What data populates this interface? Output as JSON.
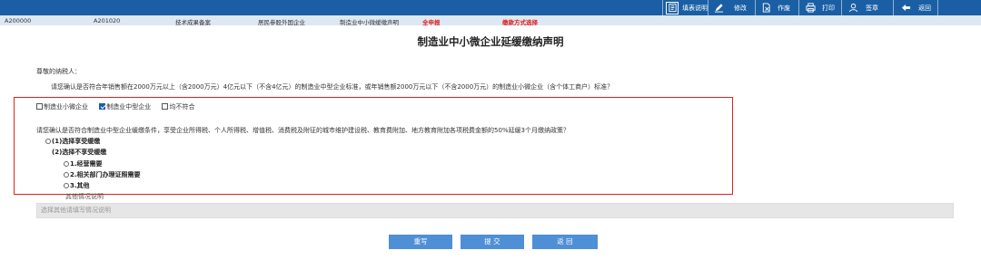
{
  "toolbar": {
    "color": "#1a5fa4",
    "buttons": [
      {
        "label": "填表说明",
        "icon": "form-guide-icon"
      },
      {
        "label": "修改",
        "icon": "pencil-icon"
      },
      {
        "label": "作废",
        "icon": "void-document-icon"
      },
      {
        "label": "打印",
        "icon": "printer-icon"
      },
      {
        "label": "签章",
        "icon": "user-sign-icon"
      },
      {
        "label": "返回",
        "icon": "back-arrow-icon"
      }
    ]
  },
  "tabs": [
    {
      "label": "A200000"
    },
    {
      "label": "A201020"
    },
    {
      "label": "技术成果备案"
    },
    {
      "label": "居民参股外国企业"
    },
    {
      "label": "制造业中小微缓缴声明"
    },
    {
      "label": "全申报"
    },
    {
      "label": "缴款方式选择"
    }
  ],
  "title": "制造业中小微企业延缓缴纳声明",
  "greeting": "尊敬的纳税人：",
  "question1": "请您确认是否符合年销售额在2000万元以上（含2000万元）4亿元以下（不含4亿元）的制造业中型企业标准，或年销售额2000万元以下（不含2000万元）的制造业小微企业（含个体工商户）标准？",
  "enterprise_options": [
    {
      "label": "制造业小微企业",
      "checked": false
    },
    {
      "label": "制造业中型企业",
      "checked": true
    },
    {
      "label": "均不符合",
      "checked": false
    }
  ],
  "question2": "请您确认是否符合制造业中型企业缓缴条件，享受企业所得税、个人所得税、增值税、消费税及附征的城市维护建设税、教育费附加、地方教育附加各项税费金额的50%延缓3个月缴纳政策？",
  "policy": {
    "opt1": "(1)选择享受缓缴",
    "opt2": "(2)选择不享受缓缴",
    "reasons": [
      "1.经营需要",
      "2.相关部门办理证照需要",
      "3.其他"
    ],
    "other_label": "其他情况说明",
    "other_placeholder": "选择其他请填写情况说明"
  },
  "buttons": {
    "reset": "重写",
    "submit": "提 交",
    "back": "返 回"
  },
  "highlight_color": "#e02020"
}
